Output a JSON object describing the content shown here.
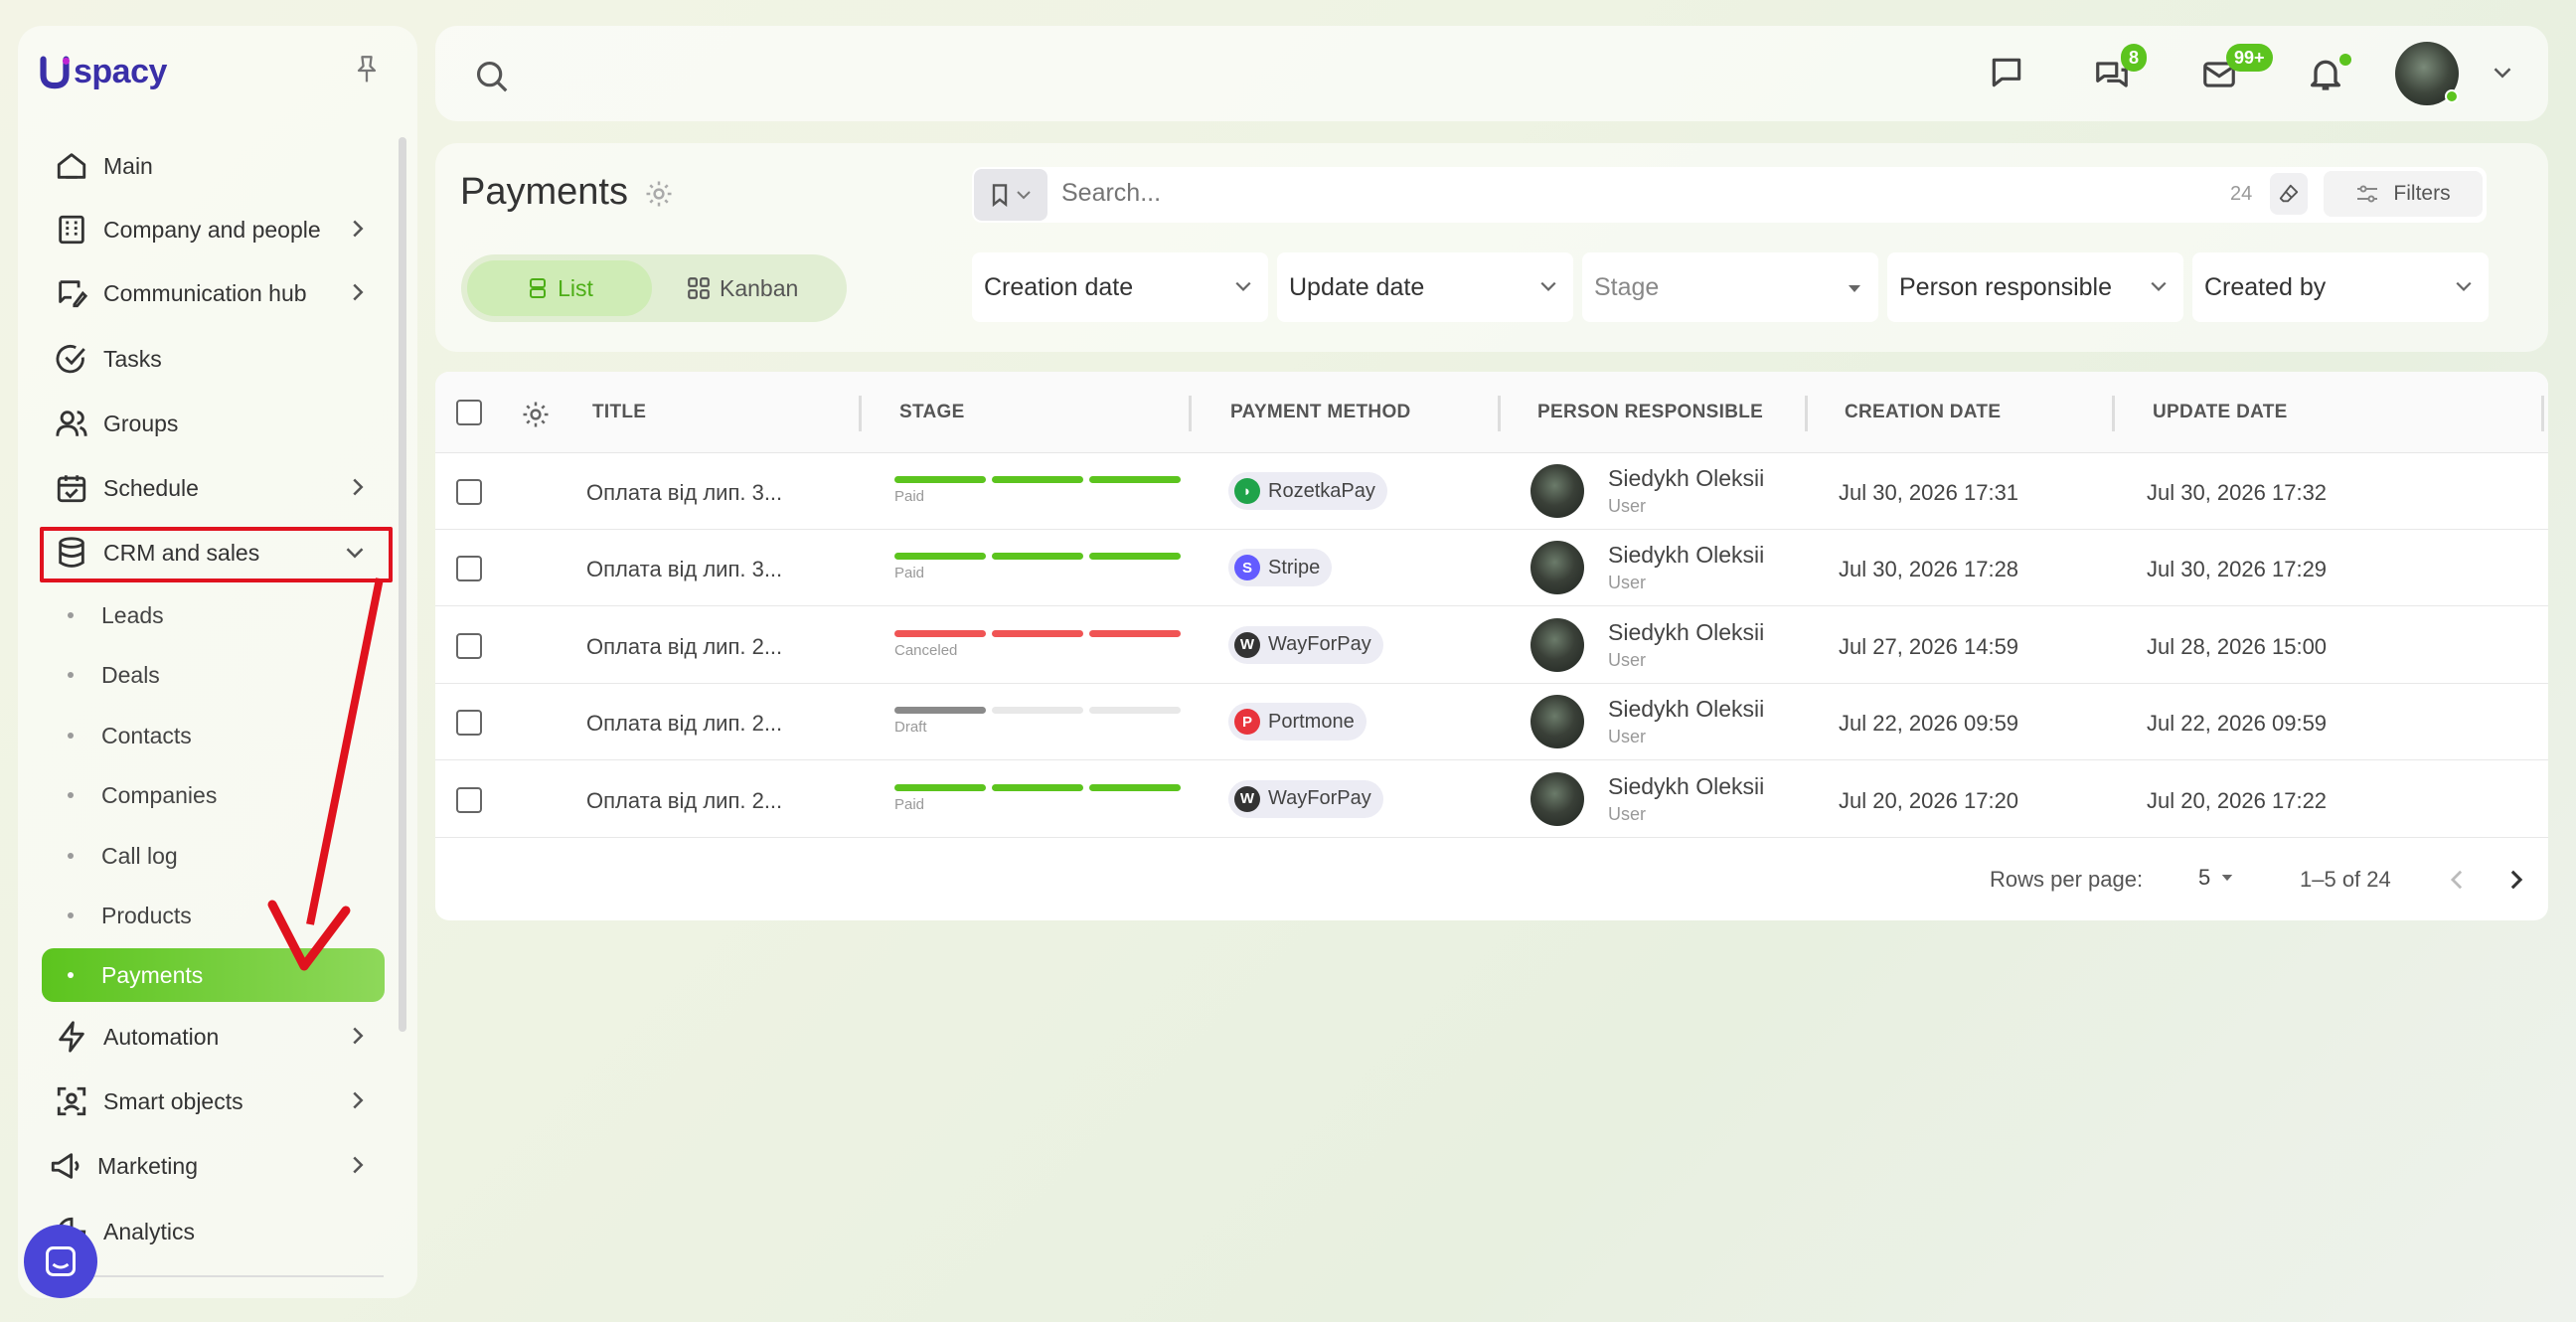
{
  "app": {
    "logo_text": "spacy"
  },
  "sidebar": {
    "items": [
      {
        "label": "Main",
        "icon": "home-icon"
      },
      {
        "label": "Company and people",
        "icon": "building-icon"
      },
      {
        "label": "Communication hub",
        "icon": "chat-edit-icon"
      },
      {
        "label": "Tasks",
        "icon": "check-circle-icon"
      },
      {
        "label": "Groups",
        "icon": "users-icon"
      },
      {
        "label": "Schedule",
        "icon": "calendar-icon"
      },
      {
        "label": "CRM and sales",
        "icon": "database-icon"
      }
    ],
    "crm_sub": [
      "Leads",
      "Deals",
      "Contacts",
      "Companies",
      "Call log",
      "Products",
      "Payments"
    ],
    "bottom_items": [
      {
        "label": "Automation",
        "icon": "bolt-icon"
      },
      {
        "label": "Smart objects",
        "icon": "scan-icon"
      },
      {
        "label": "Marketing",
        "icon": "megaphone-icon"
      },
      {
        "label": "Analytics",
        "icon": "chart-icon"
      }
    ]
  },
  "topbar": {
    "chat_badge": "8",
    "mail_badge": "99+"
  },
  "page": {
    "title": "Payments",
    "tabs": {
      "list": "List",
      "kanban": "Kanban"
    },
    "search_placeholder": "Search...",
    "search_count": "24",
    "filters_label": "Filters",
    "dropdowns": [
      "Creation date",
      "Update date",
      "Stage",
      "Person responsible",
      "Created by"
    ]
  },
  "table": {
    "columns": [
      "TITLE",
      "STAGE",
      "PAYMENT METHOD",
      "PERSON RESPONSIBLE",
      "CREATION DATE",
      "UPDATE DATE"
    ],
    "rows": [
      {
        "title": "Оплата від лип. 3...",
        "stage": "Paid",
        "method": "RozetkaPay",
        "person": "Siedykh Oleksii",
        "role": "User",
        "created": "Jul 30, 2026 17:31",
        "updated": "Jul 30, 2026 17:32"
      },
      {
        "title": "Оплата від лип. 3...",
        "stage": "Paid",
        "method": "Stripe",
        "person": "Siedykh Oleksii",
        "role": "User",
        "created": "Jul 30, 2026 17:28",
        "updated": "Jul 30, 2026 17:29"
      },
      {
        "title": "Оплата від лип. 2...",
        "stage": "Canceled",
        "method": "WayForPay",
        "person": "Siedykh Oleksii",
        "role": "User",
        "created": "Jul 27, 2026 14:59",
        "updated": "Jul 28, 2026 15:00"
      },
      {
        "title": "Оплата від лип. 2...",
        "stage": "Draft",
        "method": "Portmone",
        "person": "Siedykh Oleksii",
        "role": "User",
        "created": "Jul 22, 2026 09:59",
        "updated": "Jul 22, 2026 09:59"
      },
      {
        "title": "Оплата від лип. 2...",
        "stage": "Paid",
        "method": "WayForPay",
        "person": "Siedykh Oleksii",
        "role": "User",
        "created": "Jul 20, 2026 17:20",
        "updated": "Jul 20, 2026 17:22"
      }
    ],
    "footer": {
      "rows_per_page_label": "Rows per page:",
      "rows_per_page": "5",
      "range": "1–5 of 24"
    }
  },
  "colors": {
    "accent": "#5cc41e",
    "canceled": "#f05454",
    "draft": "#8a8a8a",
    "highlight": "#e0121e"
  }
}
